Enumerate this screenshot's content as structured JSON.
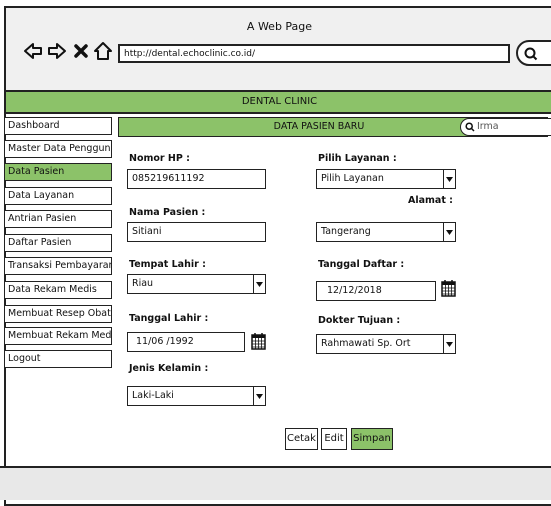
{
  "window": {
    "title": "A Web Page"
  },
  "browser": {
    "url": "http://dental.echoclinic.co.id/"
  },
  "app": {
    "name": "DENTAL CLINIC"
  },
  "sidebar": {
    "items": [
      {
        "label": "Dashboard"
      },
      {
        "label": "Master Data Pengguna"
      },
      {
        "label": "Data Pasien",
        "active": true
      },
      {
        "label": "Data Layanan"
      },
      {
        "label": "Antrian Pasien"
      },
      {
        "label": "Daftar Pasien"
      },
      {
        "label": "Transaksi Pembayaran"
      },
      {
        "label": "Data Rekam Medis"
      },
      {
        "label": "Membuat Resep Obat"
      },
      {
        "label": "Membuat Rekam Medis"
      },
      {
        "label": "Logout"
      }
    ]
  },
  "content": {
    "title": "DATA PASIEN BARU",
    "search_value": "Irma"
  },
  "form": {
    "nomor_hp": {
      "label": "Nomor HP :",
      "value": "085219611192"
    },
    "nama_pasien": {
      "label": "Nama Pasien :",
      "value": "Sitiani"
    },
    "tempat_lahir": {
      "label": "Tempat Lahir :",
      "value": "Riau"
    },
    "tanggal_lahir": {
      "label": "Tanggal Lahir :",
      "value": "11/06 /1992"
    },
    "jenis_kelamin": {
      "label": "Jenis Kelamin :",
      "value": "Laki-Laki"
    },
    "pilih_layanan": {
      "label": "Pilih Layanan :",
      "value": "Pilih Layanan"
    },
    "alamat": {
      "label": "Alamat :",
      "value": "Tangerang"
    },
    "tanggal_daftar": {
      "label": "Tanggal Daftar :",
      "value": "12/12/2018"
    },
    "dokter_tujuan": {
      "label": "Dokter Tujuan :",
      "value": "Rahmawati Sp. Ort"
    }
  },
  "actions": {
    "cetak": "Cetak",
    "edit": "Edit",
    "simpan": "Simpan"
  },
  "colors": {
    "accent": "#8cc269"
  }
}
